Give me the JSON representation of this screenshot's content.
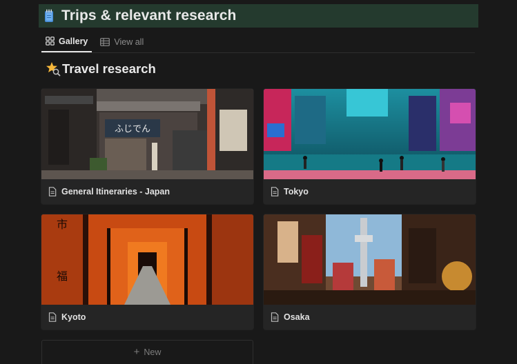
{
  "header": {
    "title": "Trips & relevant research",
    "icon": "notepad-icon",
    "background": "#243a2e"
  },
  "tabs": [
    {
      "label": "Gallery",
      "icon": "gallery-grid-icon",
      "active": true
    },
    {
      "label": "View all",
      "icon": "table-icon",
      "active": false
    }
  ],
  "section": {
    "title": "Travel research",
    "icon": "star-search-icon"
  },
  "cards": [
    {
      "label": "General Itineraries - Japan",
      "image": "tokyo-storefront-photo"
    },
    {
      "label": "Tokyo",
      "image": "tokyo-street-photo"
    },
    {
      "label": "Kyoto",
      "image": "kyoto-torii-gates-photo"
    },
    {
      "label": "Osaka",
      "image": "osaka-shinsekai-photo"
    }
  ],
  "new_button": {
    "label": "New"
  },
  "colors": {
    "background": "#191919",
    "card": "#252525",
    "text": "#e6e6e6",
    "muted": "#8d8d8d"
  }
}
